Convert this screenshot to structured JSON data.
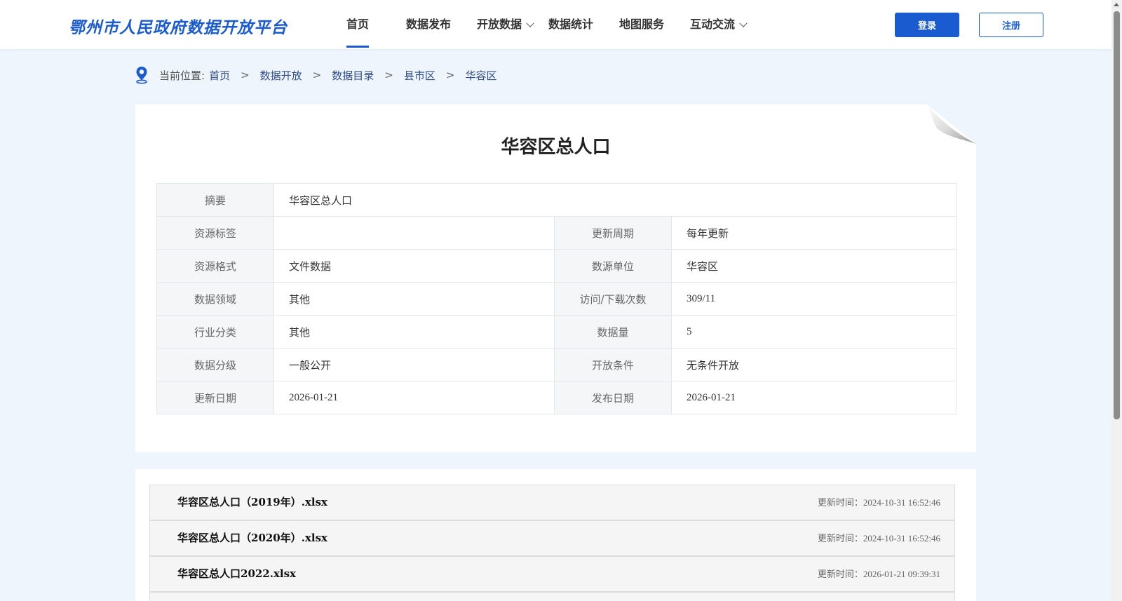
{
  "header": {
    "logo": "鄂州市人民政府数据开放平台",
    "nav": [
      "首页",
      "数据发布",
      "开放数据",
      "数据统计",
      "地图服务",
      "互动交流"
    ],
    "login": "登录",
    "register": "注册"
  },
  "breadcrumb": {
    "prefix": "当前位置:",
    "items": [
      "首页",
      "数据开放",
      "数据目录",
      "县市区",
      "华容区"
    ],
    "separator": ">"
  },
  "detail": {
    "title": "华容区总人口",
    "summary_label": "摘要",
    "summary_value": "华容区总人口",
    "rows": [
      {
        "l1": "资源标签",
        "v1": "",
        "l2": "更新周期",
        "v2": "每年更新"
      },
      {
        "l1": "资源格式",
        "v1": "文件数据",
        "l2": "数源单位",
        "v2": "华容区"
      },
      {
        "l1": "数据领域",
        "v1": "其他",
        "l2": "访问/下载次数",
        "v2": "309/11"
      },
      {
        "l1": "行业分类",
        "v1": "其他",
        "l2": "数据量",
        "v2": "5"
      },
      {
        "l1": "数据分级",
        "v1": "一般公开",
        "l2": "开放条件",
        "v2": "无条件开放"
      },
      {
        "l1": "更新日期",
        "v1": "2026-01-21",
        "l2": "发布日期",
        "v2": "2026-01-21"
      }
    ]
  },
  "files": [
    {
      "name": "华容区总人口（2019年）.xlsx",
      "time": "更新时间：2024-10-31 16:52:46"
    },
    {
      "name": "华容区总人口（2020年）.xlsx",
      "time": "更新时间：2024-10-31 16:52:46"
    },
    {
      "name": "华容区总人口2022.xlsx",
      "time": "更新时间：2026-01-21 09:39:31"
    }
  ],
  "colors": {
    "accent": "#1a5bd0",
    "page_bg": "#eef5fd",
    "label_bg": "#f5f6f7"
  }
}
